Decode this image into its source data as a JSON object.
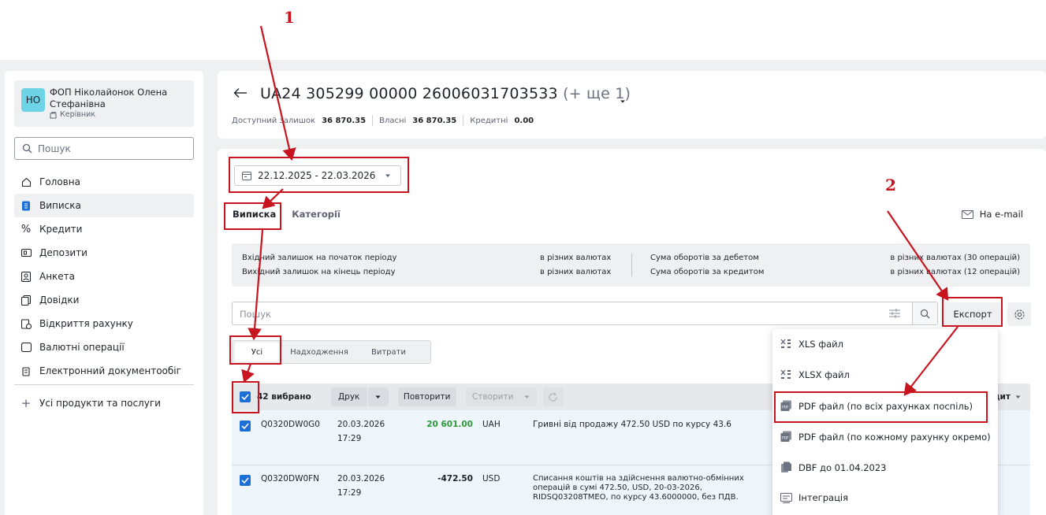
{
  "user": {
    "initials": "НО",
    "name": "ФОП Ніколайонок Олена Стефанівна",
    "role": "Керівник"
  },
  "sidebar": {
    "search_placeholder": "Пошук",
    "items": [
      {
        "label": "Головна",
        "icon": "home-icon"
      },
      {
        "label": "Виписка",
        "icon": "statement-icon",
        "active": true
      },
      {
        "label": "Кредити",
        "icon": "percent-icon"
      },
      {
        "label": "Депозити",
        "icon": "deposit-icon"
      },
      {
        "label": "Анкета",
        "icon": "profile-icon"
      },
      {
        "label": "Довідки",
        "icon": "documents-icon"
      },
      {
        "label": "Відкриття рахунку",
        "icon": "open-account-icon"
      },
      {
        "label": "Валютні операції",
        "icon": "currency-icon"
      },
      {
        "label": "Електронний документообіг",
        "icon": "edoc-icon"
      }
    ],
    "all_products": "Усі продукти та послуги"
  },
  "header": {
    "account": "UA24 305299 00000 26006031703533",
    "account_more": "(+ ще 1)",
    "available_label": "Доступний залишок",
    "available_value": "36 870.35",
    "own_label": "Власні",
    "own_value": "36 870.35",
    "credit_label": "Кредитні",
    "credit_value": "0.00"
  },
  "date_range": "22.12.2025 - 22.03.2026",
  "tabs": {
    "statement": "Виписка",
    "categories": "Категорії"
  },
  "email_link": "На e-mail",
  "summary": {
    "opening_label": "Вхідний залишок на початок періоду",
    "opening_value": "в різних валютах",
    "closing_label": "Вихідний залишок на кінець періоду",
    "closing_value": "в різних валютах",
    "debit_label": "Сума оборотів за дебетом",
    "debit_value": "в різних валютах  (30 операцій)",
    "credit_label": "Сума оборотів за кредитом",
    "credit_value": "в різних валютах  (12 операцій)"
  },
  "search_placeholder": "Пошук",
  "export_label": "Експорт",
  "segments": {
    "all": "Усі",
    "income": "Надходження",
    "expense": "Витрати"
  },
  "toolbar": {
    "selected": "42 вибрано",
    "print": "Друк",
    "repeat": "Повторити",
    "create": "Створити",
    "credit_col": "Кредит"
  },
  "rows": [
    {
      "id": "Q0320DW0G0",
      "date": "20.03.2026",
      "time": "17:29",
      "amount": "20 601.00",
      "currency": "UAH",
      "description": "Гривні від продажу 472.50 USD по курсу 43.6"
    },
    {
      "id": "Q0320DW0FN",
      "date": "20.03.2026",
      "time": "17:29",
      "amount": "-472.50",
      "currency": "USD",
      "description": "Списання коштів на здійснення валютно-обмінних операцій в сумі 472.50, USD, 20-03-2026, RIDSQ03208TMEO, по курсу 43.6000000, без ПДВ."
    }
  ],
  "export_menu": [
    {
      "label": "XLS файл",
      "icon": "xls-icon"
    },
    {
      "label": "XLSX файл",
      "icon": "xlsx-icon"
    },
    {
      "label": "PDF файл (по всіх рахунках поспіль)",
      "icon": "pdf-icon"
    },
    {
      "label": "PDF файл (по кожному рахунку окремо)",
      "icon": "pdf-icon"
    },
    {
      "label": "DBF до 01.04.2023",
      "icon": "dbf-icon"
    },
    {
      "label": "Інтеграція",
      "icon": "integration-icon"
    }
  ],
  "annotations": {
    "step1": "1",
    "step2": "2"
  },
  "colors": {
    "accent": "#1d6fd8",
    "annotation": "#c8141e",
    "positive": "#2e9a3a",
    "avatar": "#6fd3e6"
  }
}
